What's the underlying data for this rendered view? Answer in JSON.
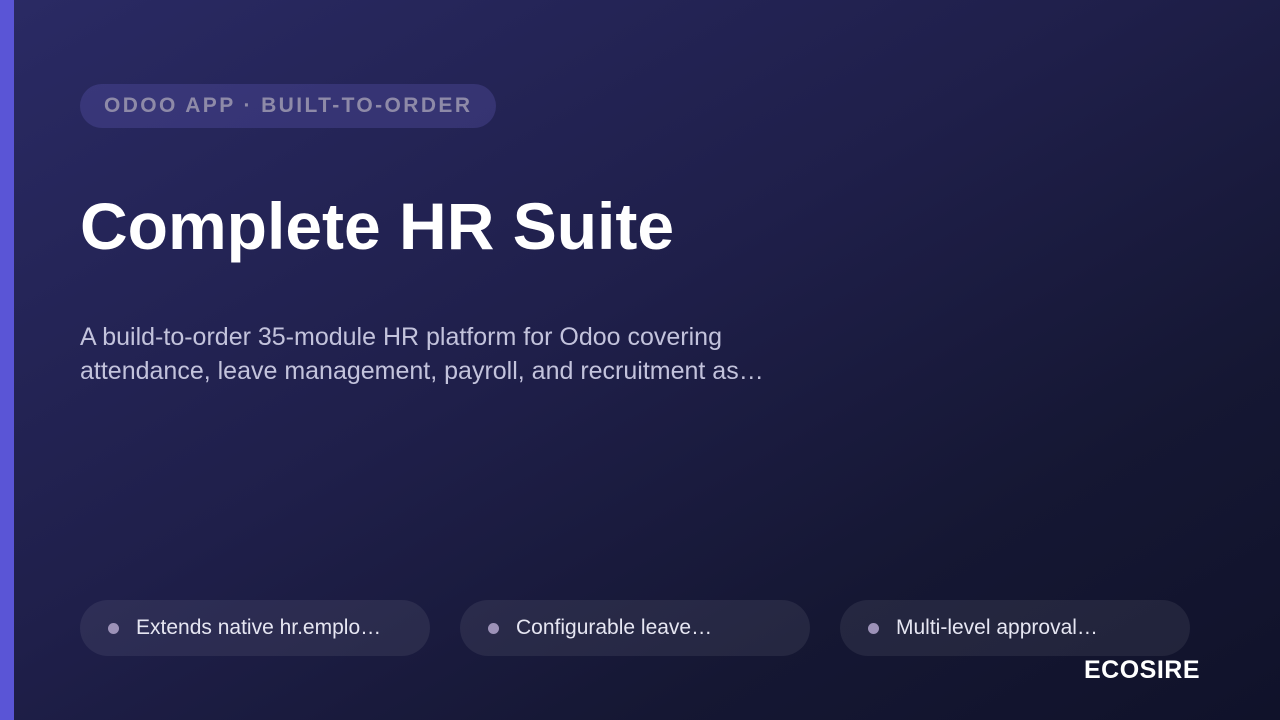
{
  "eyebrow": "ODOO APP · BUILT-TO-ORDER",
  "title": "Complete HR Suite",
  "subtitle": "A build-to-order 35-module HR platform for Odoo covering attendance, leave management, payroll, and recruitment as…",
  "features": [
    {
      "label": "Extends native hr.emplo…"
    },
    {
      "label": "Configurable leave…"
    },
    {
      "label": "Multi-level approval…"
    }
  ],
  "brand": "ECOSIRE",
  "colors": {
    "accent": "#5a55d6",
    "background": "#1f1f4a",
    "text": "#ffffff"
  }
}
